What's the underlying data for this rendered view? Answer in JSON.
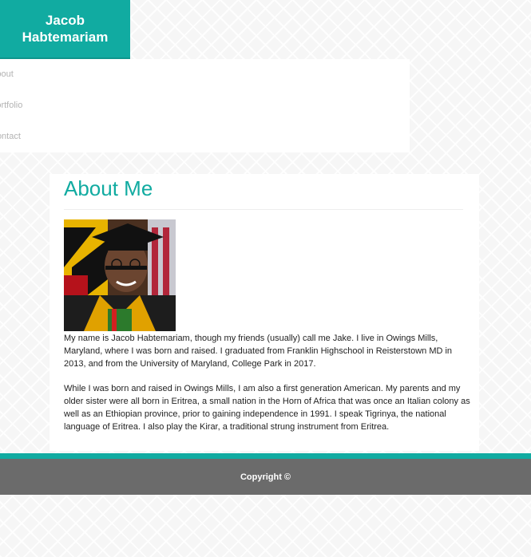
{
  "brand": {
    "line1": "Jacob",
    "line2": "Habtemariam"
  },
  "nav": {
    "items": [
      {
        "label": "About"
      },
      {
        "label": "Portfolio"
      },
      {
        "label": "Contact"
      }
    ]
  },
  "main": {
    "title": "About Me",
    "photo_icon": "profile-photo",
    "paragraphs": [
      "My name is Jacob Habtemariam, though my friends (usually) call me Jake. I live in Owings Mills, Maryland, where I was born and raised. I graduated from Franklin Highschool in Reisterstown MD in 2013, and from the University of Maryland, College Park in 2017.",
      "While I was born and raised in Owings Mills, I am also a first generation American. My parents and my older sister were all born in Eritrea, a small nation in the Horn of Africa that was once an Italian colony as well as an Ethiopian province, prior to gaining independence in 1991. I speak Tigrinya, the national language of Eritrea. I also play the Kirar, a traditional strung instrument from Eritrea."
    ]
  },
  "footer": {
    "copyright": "Copyright ©"
  },
  "colors": {
    "accent": "#11aba1",
    "footer": "#6b6b6b"
  }
}
